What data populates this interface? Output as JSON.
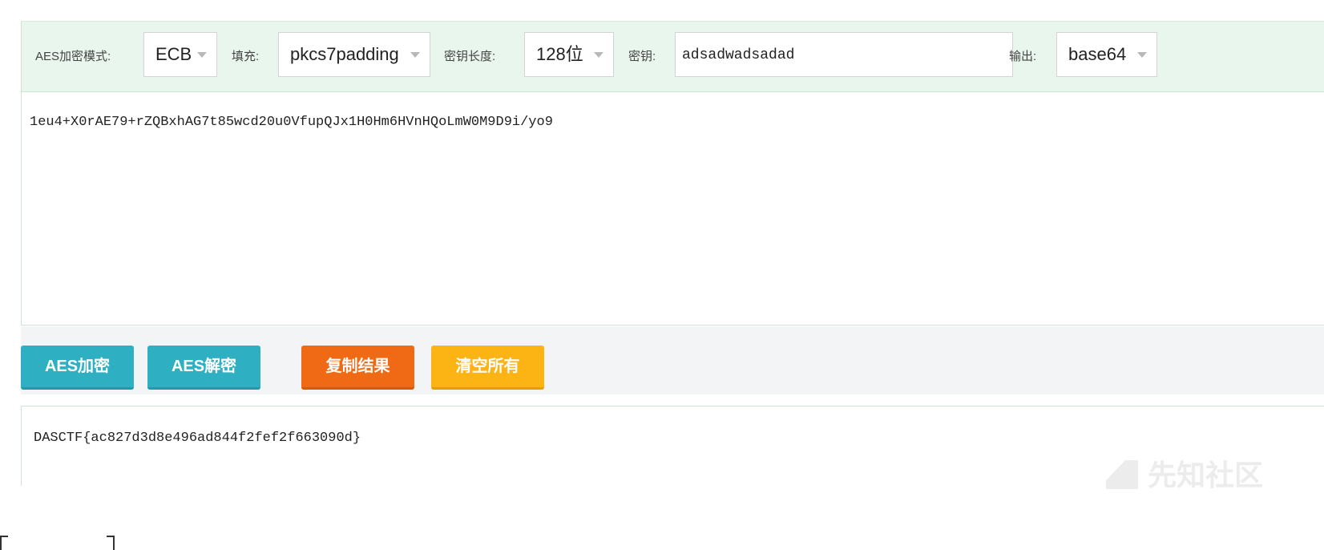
{
  "toolbar": {
    "mode_label": "AES加密模式:",
    "mode_value": "ECB",
    "padding_label": "填充:",
    "padding_value": "pkcs7padding",
    "keylen_label": "密钥长度:",
    "keylen_value": "128位",
    "key_label": "密钥:",
    "key_value": "adsadwadsadad",
    "output_label": "输出:",
    "output_value": "base64"
  },
  "input": {
    "text": "1eu4+X0rAE79+rZQBxhAG7t85wcd20u0VfupQJx1H0Hm6HVnHQoLmW0M9D9i/yo9"
  },
  "buttons": {
    "encrypt": "AES加密",
    "decrypt": "AES解密",
    "copy": "复制结果",
    "clear": "清空所有"
  },
  "output": {
    "text": "DASCTF{ac827d3d8e496ad844f2fef2f663090d}"
  },
  "watermark": "先知社区",
  "colors": {
    "toolbar_bg": "#e9f6ee",
    "teal": "#2fb0c2",
    "orange": "#f06a15",
    "yellow": "#fbb414"
  }
}
